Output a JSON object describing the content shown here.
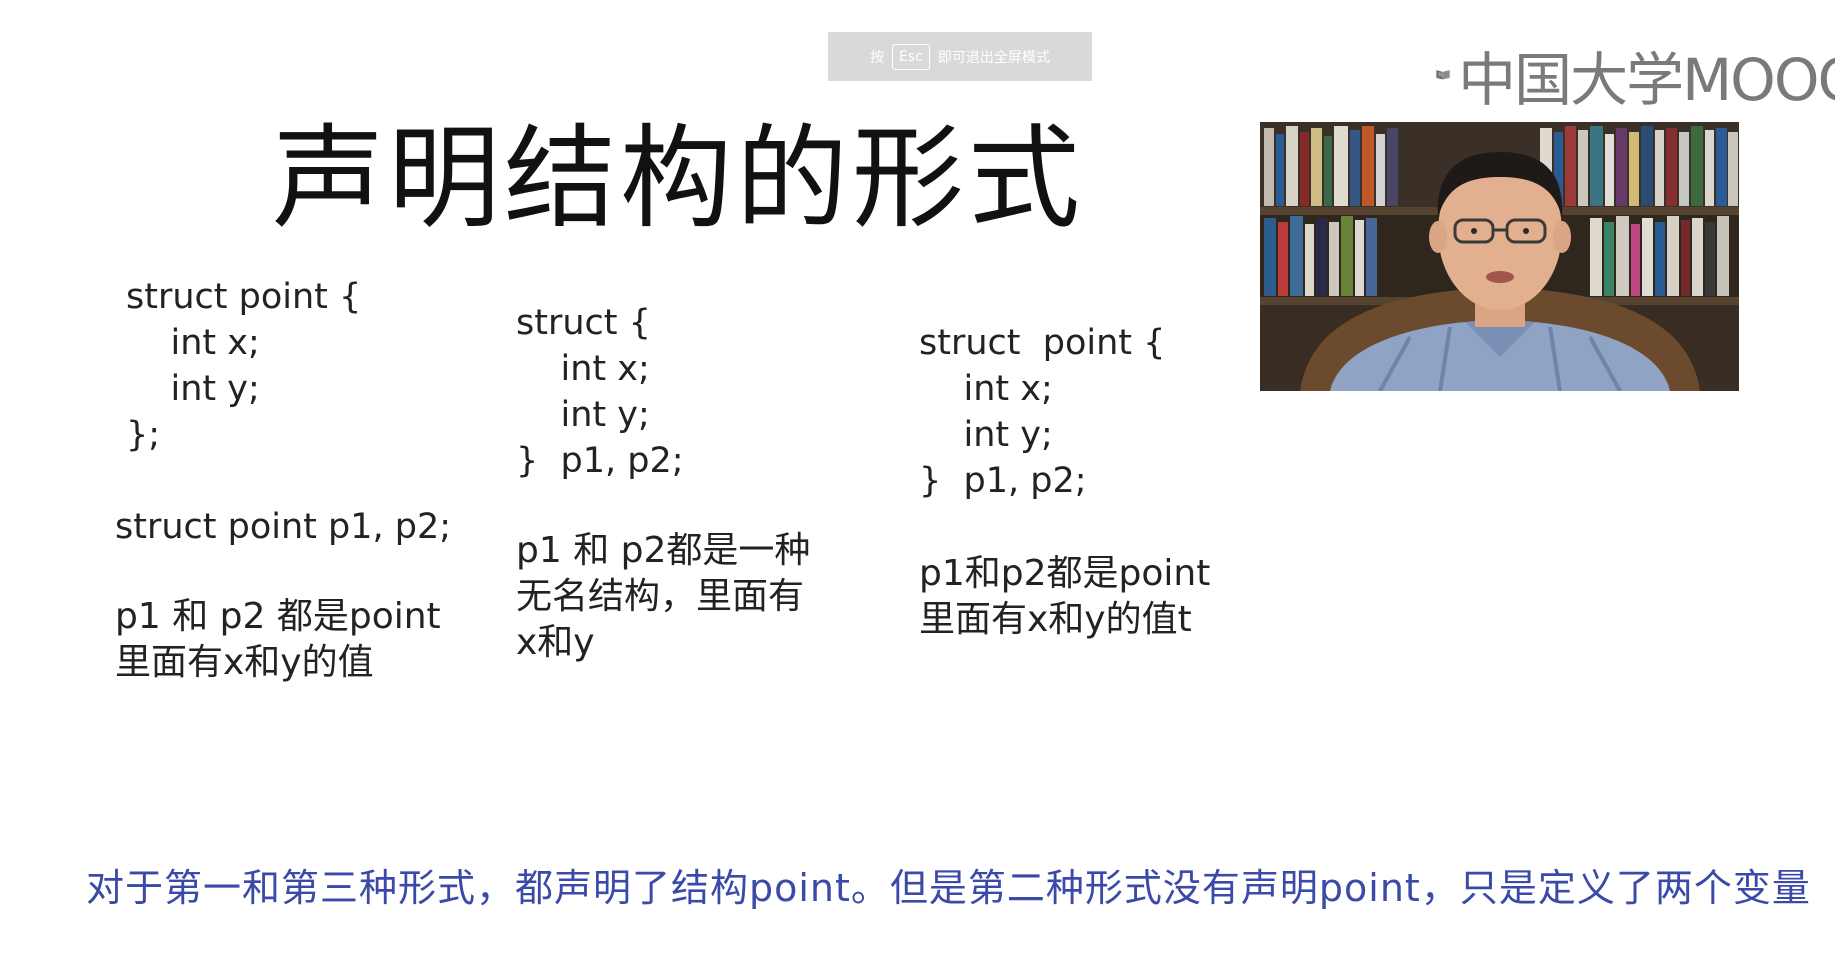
{
  "exit_hint": {
    "prefix": "按",
    "key": "Esc",
    "suffix": "即可退出全屏模式"
  },
  "brand": {
    "logo_text": "中国大学MOOC",
    "logo_icon": "mooc-book-icon"
  },
  "slide": {
    "title": "声明结构的形式",
    "col1": {
      "code": "struct point {\n    int x;\n    int y;\n};",
      "decl": "struct point p1, p2;",
      "note": "p1 和 p2 都是point\n里面有x和y的值"
    },
    "col2": {
      "code": "struct {\n    int x;\n    int y;\n}  p1, p2;",
      "note": "p1 和 p2都是一种\n无名结构，里面有\nx和y"
    },
    "col3": {
      "code": "struct  point {\n    int x;\n    int y;\n}  p1, p2;",
      "note": "p1和p2都是point\n里面有x和y的值t"
    }
  },
  "subtitle": "对于第一和第三种形式，都声明了结构point。但是第二种形式没有声明point，只是定义了两个变量",
  "colors": {
    "subtitle": "#3b49a8",
    "esc_bg": "#d9d9d9",
    "logo": "#7a7a7a"
  }
}
